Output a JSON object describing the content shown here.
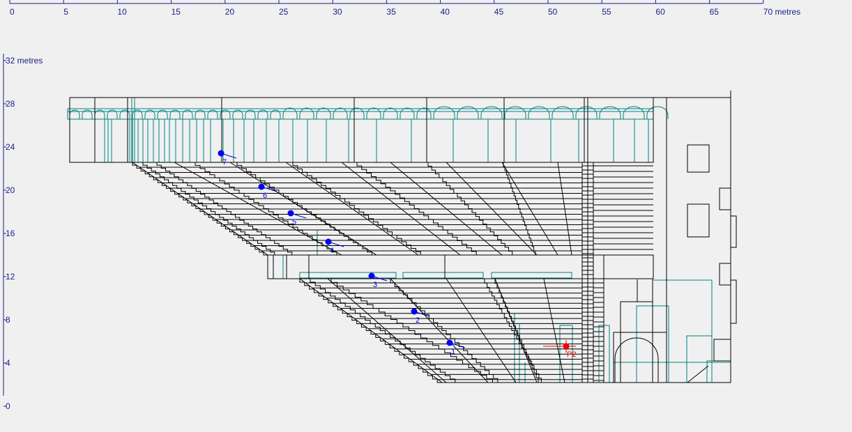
{
  "x_axis": {
    "ticks": [
      "0",
      "5",
      "10",
      "15",
      "20",
      "25",
      "30",
      "35",
      "40",
      "45",
      "50",
      "55",
      "60",
      "65",
      "70 metres"
    ]
  },
  "y_axis": {
    "ticks": [
      "0",
      "4",
      "8",
      "12",
      "16",
      "20",
      "24",
      "28",
      "32 metres"
    ]
  },
  "points_blue": [
    {
      "label": "1"
    },
    {
      "label": "2"
    },
    {
      "label": "3"
    },
    {
      "label": "4"
    },
    {
      "label": "5"
    },
    {
      "label": "6"
    },
    {
      "label": "7"
    }
  ],
  "points_red": [
    {
      "label": "P2"
    }
  ],
  "colors": {
    "axis": "#1a1a8c",
    "structure": "#000000",
    "secondary": "#008080",
    "point_blue": "#0000ee",
    "point_red": "#ee0000",
    "background": "#f0f0f0"
  }
}
